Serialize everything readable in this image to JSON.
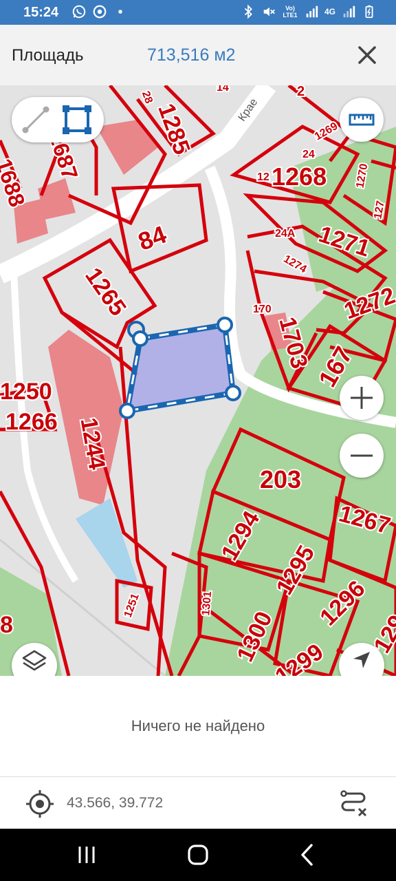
{
  "status_bar": {
    "time": "15:24",
    "left_icons": [
      "whatsapp-icon",
      "chrome-icon",
      "dot-icon"
    ],
    "right_icons": [
      "bluetooth-icon",
      "mute-icon",
      "volte-icon",
      "signal-icon",
      "4g-icon",
      "signal-icon",
      "battery-icon"
    ],
    "volte_label": "Vo) LTE1",
    "network_label": "4G"
  },
  "header": {
    "label": "Площадь",
    "value": "713,516 м2",
    "close_icon": "close-icon"
  },
  "map": {
    "mode_buttons": [
      "line-measure-icon",
      "polygon-measure-icon"
    ],
    "ruler_icon": "ruler-icon",
    "zoom_in_icon": "plus-icon",
    "zoom_out_icon": "minus-icon",
    "layers_icon": "layers-icon",
    "locate_icon": "navigation-arrow-icon",
    "colors": {
      "parcel_border": "#d4000c",
      "measure_line": "#1a66b0",
      "measure_fill": "#a9a8e8",
      "park": "#a8d59e",
      "building": "#e8868a",
      "water": "#a8d4ec",
      "road": "#ffffff"
    },
    "street_label": "Крае",
    "parcel_labels": [
      "1285",
      "1687",
      "1688",
      "1268",
      "1270",
      "127",
      "1269",
      "24",
      "24А",
      "1271",
      "1274",
      "1272",
      "84",
      "1265",
      "170",
      "1703",
      "167",
      "1250",
      "1266",
      "1244",
      "203",
      "1267",
      "1294",
      "1295",
      "1296",
      "1301",
      "1300",
      "1299",
      "129",
      "1251",
      "8",
      "2",
      "14",
      "12",
      "28"
    ]
  },
  "panel": {
    "message": "Ничего не найдено"
  },
  "coords": {
    "target_icon": "crosshair-icon",
    "value": "43.566, 39.772",
    "route_icon": "route-clear-icon"
  },
  "nav_bar": {
    "buttons": [
      "recents-icon",
      "home-icon",
      "back-icon"
    ]
  }
}
